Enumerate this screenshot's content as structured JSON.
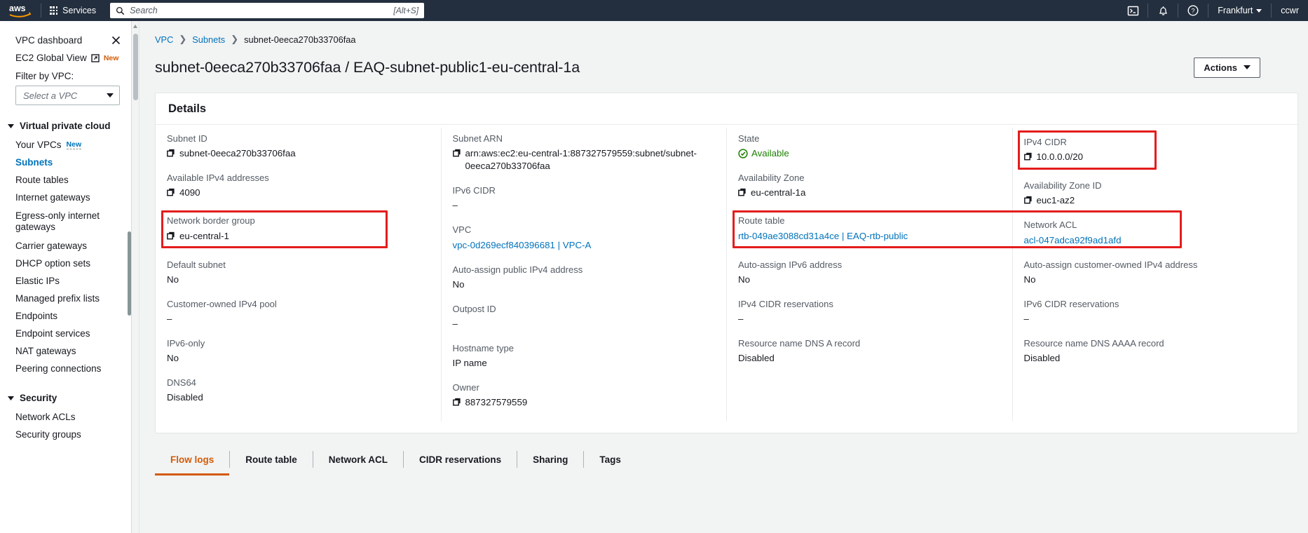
{
  "topnav": {
    "logo": "aws-logo",
    "services_label": "Services",
    "search_placeholder": "Search",
    "search_value": "",
    "search_shortcut": "[Alt+S]",
    "cloudshell_icon": "cloudshell-icon",
    "notifications_icon": "bell-icon",
    "help_icon": "question-circle-icon",
    "region_label": "Frankfurt",
    "account_label": "ccwr"
  },
  "sidebar": {
    "title": "VPC dashboard",
    "close_icon": "close-icon",
    "ec2_global_view": {
      "label": "EC2 Global View",
      "external_icon": "external-link-icon",
      "badge": "New"
    },
    "filter_label": "Filter by VPC:",
    "filter_placeholder": "Select a VPC",
    "groups": [
      {
        "label": "Virtual private cloud",
        "expanded": true,
        "items": [
          {
            "label": "Your VPCs",
            "badge": "New",
            "active": false
          },
          {
            "label": "Subnets",
            "active": true
          },
          {
            "label": "Route tables",
            "active": false
          },
          {
            "label": "Internet gateways",
            "active": false
          },
          {
            "label": "Egress-only internet gateways",
            "active": false
          },
          {
            "label": "Carrier gateways",
            "active": false
          },
          {
            "label": "DHCP option sets",
            "active": false
          },
          {
            "label": "Elastic IPs",
            "active": false
          },
          {
            "label": "Managed prefix lists",
            "active": false
          },
          {
            "label": "Endpoints",
            "active": false
          },
          {
            "label": "Endpoint services",
            "active": false
          },
          {
            "label": "NAT gateways",
            "active": false
          },
          {
            "label": "Peering connections",
            "active": false
          }
        ]
      },
      {
        "label": "Security",
        "expanded": true,
        "items": [
          {
            "label": "Network ACLs",
            "active": false
          },
          {
            "label": "Security groups",
            "active": false
          }
        ]
      }
    ]
  },
  "breadcrumb": {
    "items": [
      "VPC",
      "Subnets",
      "subnet-0eeca270b33706faa"
    ]
  },
  "page": {
    "title": "subnet-0eeca270b33706faa / EAQ-subnet-public1-eu-central-1a",
    "actions_label": "Actions"
  },
  "details": {
    "title": "Details",
    "col1": [
      {
        "label": "Subnet ID",
        "value": "subnet-0eeca270b33706faa",
        "copy": true
      },
      {
        "label": "Available IPv4 addresses",
        "value": "4090",
        "copy": true
      },
      {
        "label": "Network border group",
        "value": "eu-central-1",
        "copy": true,
        "highlight": true
      },
      {
        "label": "Default subnet",
        "value": "No"
      },
      {
        "label": "Customer-owned IPv4 pool",
        "value": "–"
      },
      {
        "label": "IPv6-only",
        "value": "No"
      },
      {
        "label": "DNS64",
        "value": "Disabled"
      }
    ],
    "col2": [
      {
        "label": "Subnet ARN",
        "value": "arn:aws:ec2:eu-central-1:887327579559:subnet/subnet-0eeca270b33706faa",
        "copy": true
      },
      {
        "label": "IPv6 CIDR",
        "value": "–"
      },
      {
        "label": "VPC",
        "value": "vpc-0d269ecf840396681 | VPC-A",
        "link": true
      },
      {
        "label": "Auto-assign public IPv4 address",
        "value": "No"
      },
      {
        "label": "Outpost ID",
        "value": "–"
      },
      {
        "label": "Hostname type",
        "value": "IP name"
      },
      {
        "label": "Owner",
        "value": "887327579559",
        "copy": true
      }
    ],
    "col3": [
      {
        "label": "State",
        "value": "Available",
        "state_ok": true
      },
      {
        "label": "Availability Zone",
        "value": "eu-central-1a",
        "copy": true
      },
      {
        "label": "Route table",
        "value": "rtb-049ae3088cd31a4ce | EAQ-rtb-public",
        "link": true,
        "highlight": true
      },
      {
        "label": "Auto-assign IPv6 address",
        "value": "No"
      },
      {
        "label": "IPv4 CIDR reservations",
        "value": "–"
      },
      {
        "label": "Resource name DNS A record",
        "value": "Disabled"
      }
    ],
    "col4": [
      {
        "label": "IPv4 CIDR",
        "value": "10.0.0.0/20",
        "copy": true,
        "highlight": true
      },
      {
        "label": "Availability Zone ID",
        "value": "euc1-az2",
        "copy": true
      },
      {
        "label": "Network ACL",
        "value": "acl-047adca92f9ad1afd",
        "link": true
      },
      {
        "label": "Auto-assign customer-owned IPv4 address",
        "value": "No"
      },
      {
        "label": "IPv6 CIDR reservations",
        "value": "–"
      },
      {
        "label": "Resource name DNS AAAA record",
        "value": "Disabled"
      }
    ]
  },
  "tabs": [
    {
      "label": "Flow logs",
      "active": true
    },
    {
      "label": "Route table",
      "active": false
    },
    {
      "label": "Network ACL",
      "active": false
    },
    {
      "label": "CIDR reservations",
      "active": false
    },
    {
      "label": "Sharing",
      "active": false
    },
    {
      "label": "Tags",
      "active": false
    }
  ],
  "colors": {
    "nav_bg": "#232f3e",
    "link": "#0073bb",
    "accent_orange": "#d45b07",
    "state_green": "#1d8102",
    "annotation_red": "#e31d1c"
  }
}
